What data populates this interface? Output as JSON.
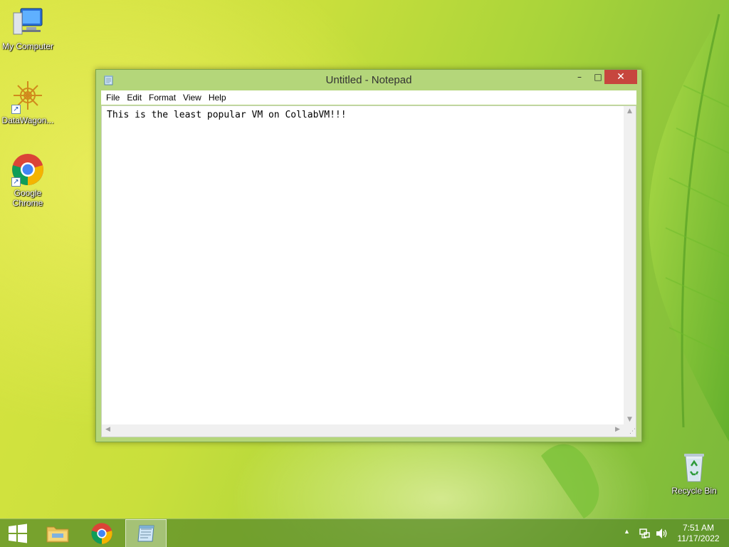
{
  "desktop": {
    "icons": [
      {
        "label": "My Computer",
        "icon": "computer-icon"
      },
      {
        "label": "DataWagon...",
        "icon": "datawagon-icon"
      },
      {
        "label": "Google Chrome",
        "icon": "chrome-icon"
      },
      {
        "label": "Recycle Bin",
        "icon": "recycle-bin-icon"
      }
    ]
  },
  "window": {
    "title": "Untitled - Notepad",
    "buttons": {
      "minimize": "–",
      "maximize": "□",
      "close": "✕"
    },
    "menu": [
      "File",
      "Edit",
      "Format",
      "View",
      "Help"
    ],
    "content": "This is the least popular VM on CollabVM!!!"
  },
  "taskbar": {
    "items": [
      {
        "name": "start-button",
        "icon": "windows-logo-icon"
      },
      {
        "name": "file-explorer",
        "icon": "folder-icon"
      },
      {
        "name": "google-chrome",
        "icon": "chrome-icon"
      },
      {
        "name": "notepad",
        "icon": "notepad-icon",
        "active": true
      }
    ],
    "tray": {
      "time": "7:51 AM",
      "date": "11/17/2022"
    }
  },
  "colors": {
    "close_button": "#c7463e",
    "window_frame": "#b4d67a",
    "taskbar": "#5a8c28"
  }
}
